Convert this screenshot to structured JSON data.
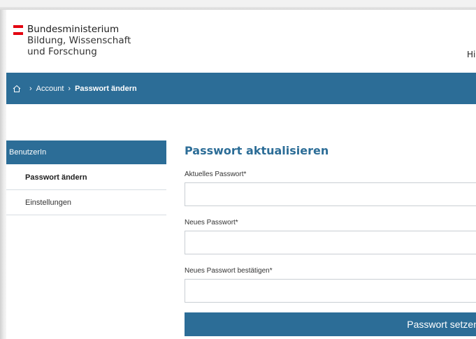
{
  "header": {
    "logo_line1": "Bundesministerium",
    "logo_line2": "Bildung, Wissenschaft",
    "logo_line3": "und Forschung",
    "link_partial": "Hi"
  },
  "breadcrumb": {
    "home_icon": "home-icon",
    "items": [
      "Account",
      "Passwort ändern"
    ]
  },
  "sidebar": {
    "heading": "BenutzerIn",
    "items": [
      {
        "label": "Passwort ändern",
        "active": true
      },
      {
        "label": "Einstellungen",
        "active": false
      }
    ]
  },
  "form": {
    "title": "Passwort aktualisieren",
    "fields": [
      {
        "label": "Aktuelles Passwort*",
        "value": ""
      },
      {
        "label": "Neues Passwort*",
        "value": ""
      },
      {
        "label": "Neues Passwort bestätigen*",
        "value": ""
      }
    ],
    "submit_label": "Passwort setzen"
  },
  "colors": {
    "brand_blue": "#2c6d97",
    "flag_red": "#e3000f"
  }
}
